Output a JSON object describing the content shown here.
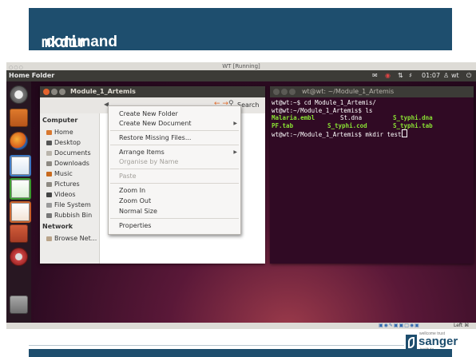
{
  "slide": {
    "title_mono": "mkdir",
    "title_rest": " command"
  },
  "vm": {
    "window_title": "WT [Running]",
    "topbar": {
      "app_title": "Home Folder",
      "clock": "01:07",
      "user": "wt"
    },
    "nautilus": {
      "title": "Module_1_Artemis",
      "search_label": "Search",
      "sidebar": {
        "computer_heading": "Computer",
        "computer_items": [
          "Home",
          "Desktop",
          "Documents",
          "Downloads",
          "Music",
          "Pictures",
          "Videos",
          "File System",
          "Rubbish Bin"
        ],
        "network_heading": "Network",
        "network_items": [
          "Browse Net..."
        ]
      }
    },
    "context_menu": {
      "create_folder": "Create New Folder",
      "create_document": "Create New Document",
      "restore_missing": "Restore Missing Files...",
      "arrange_items": "Arrange Items",
      "organise_by_name": "Organise by Name",
      "paste": "Paste",
      "zoom_in": "Zoom In",
      "zoom_out": "Zoom Out",
      "normal_size": "Normal Size",
      "properties": "Properties"
    },
    "terminal": {
      "title": "wt@wt: ~/Module_1_Artemis",
      "line1": "wt@wt:~$ cd Module_1_Artemis/",
      "line2": "wt@wt:~/Module_1_Artemis$ ls",
      "ls_col1": [
        "Malaria.embl",
        "PF.tab"
      ],
      "ls_col2": [
        "St.dna",
        "S_typhi.cod"
      ],
      "ls_col3": [
        "S_typhi.dna",
        "S_typhi.tab"
      ],
      "line5": "wt@wt:~/Module_1_Artemis$ mkdir test"
    },
    "statusbar": {
      "host_key": "Left ⌘"
    }
  },
  "logo": {
    "small_text": "wellcome trust",
    "brand": "sanger",
    "sub": "institute"
  },
  "colors": {
    "slide_blue": "#1e4e6e",
    "terminal_bg": "#300a24",
    "terminal_green": "#8ae234",
    "ubuntu_dark": "#3c3b37"
  }
}
